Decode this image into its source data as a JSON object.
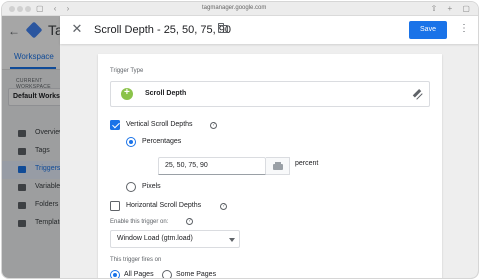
{
  "browser": {
    "url": "tagmanager.google.com"
  },
  "app": {
    "title_partial": "Tag",
    "workspace_tab": "Workspace",
    "current_workspace_label": "CURRENT WORKSPACE",
    "current_workspace_name": "Default Workspace",
    "nav": [
      {
        "label": "Overview",
        "icon": "overview-icon",
        "active": false
      },
      {
        "label": "Tags",
        "icon": "tag-icon",
        "active": false
      },
      {
        "label": "Triggers",
        "icon": "trigger-icon",
        "active": true
      },
      {
        "label": "Variables",
        "icon": "variable-icon",
        "active": false
      },
      {
        "label": "Folders",
        "icon": "folder-icon",
        "active": false
      },
      {
        "label": "Templates",
        "icon": "template-icon",
        "active": false
      }
    ]
  },
  "panel": {
    "title": "Scroll Depth - 25, 50, 75, 90",
    "save_label": "Save",
    "trigger_type_label": "Trigger Type",
    "trigger_type_name": "Scroll Depth",
    "vertical": {
      "label": "Vertical Scroll Depths",
      "checked": true,
      "percentages_label": "Percentages",
      "percentages_selected": true,
      "percentages_value": "25, 50, 75, 90",
      "unit": "percent",
      "pixels_label": "Pixels",
      "pixels_selected": false
    },
    "horizontal": {
      "label": "Horizontal Scroll Depths",
      "checked": false
    },
    "enable_label": "Enable this trigger on:",
    "enable_value": "Window Load (gtm.load)",
    "fires_on_label": "This trigger fires on",
    "fires_options": [
      {
        "label": "All Pages",
        "selected": true
      },
      {
        "label": "Some Pages",
        "selected": false
      }
    ]
  },
  "colors": {
    "accent": "#1a73e8",
    "trigger_icon": "#8bc34a"
  }
}
